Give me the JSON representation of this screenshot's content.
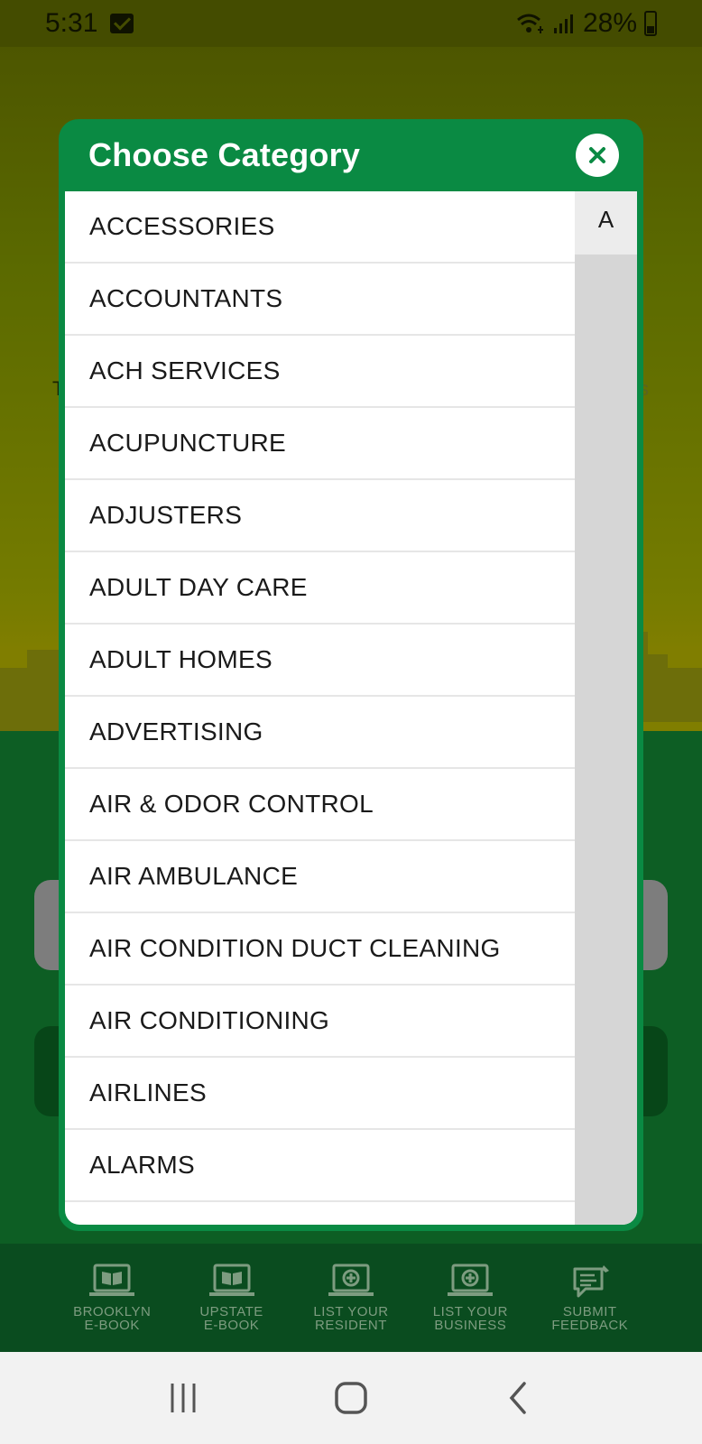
{
  "status_bar": {
    "time": "5:31",
    "battery": "28%"
  },
  "modal": {
    "title": "Choose Category",
    "categories": [
      "ACCESSORIES",
      "ACCOUNTANTS",
      "ACH SERVICES",
      "ACUPUNCTURE",
      "ADJUSTERS",
      "ADULT DAY CARE",
      "ADULT HOMES",
      "ADVERTISING",
      "AIR & ODOR CONTROL",
      "AIR AMBULANCE",
      "AIR CONDITION DUCT CLEANING",
      "AIR CONDITIONING",
      "AIRLINES",
      "ALARMS",
      ""
    ],
    "index_letters": [
      "A"
    ]
  },
  "bottom_nav": {
    "items": [
      {
        "label": "BROOKLYN\nE-BOOK",
        "icon": "ebook-icon"
      },
      {
        "label": "UPSTATE\nE-BOOK",
        "icon": "ebook-icon"
      },
      {
        "label": "LIST YOUR\nRESIDENT",
        "icon": "add-listing-icon"
      },
      {
        "label": "LIST YOUR\nBUSINESS",
        "icon": "add-listing-icon"
      },
      {
        "label": "SUBMIT\nFEEDBACK",
        "icon": "feedback-icon"
      }
    ]
  },
  "colors": {
    "modal_green": "#0a8a43",
    "nav_green": "#0a4c1f",
    "nav_label": "#7d9c80"
  }
}
